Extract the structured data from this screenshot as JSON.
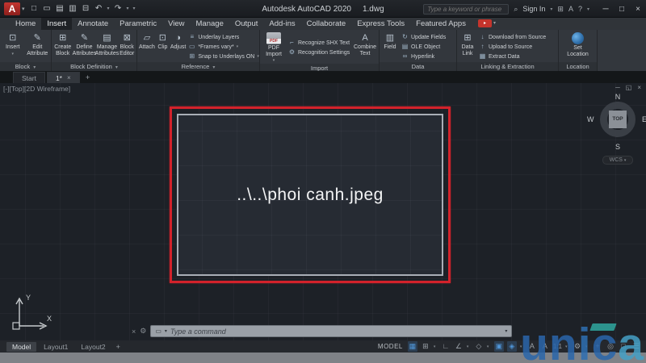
{
  "titlebar": {
    "app_title": "Autodesk AutoCAD 2020",
    "doc_title": "1.dwg",
    "search_placeholder": "Type a keyword or phrase",
    "sign_in": "Sign In"
  },
  "ribbon_tabs": [
    "Home",
    "Insert",
    "Annotate",
    "Parametric",
    "View",
    "Manage",
    "Output",
    "Add-ins",
    "Collaborate",
    "Express Tools",
    "Featured Apps"
  ],
  "panels": {
    "block": {
      "label": "Block",
      "insert": "Insert",
      "edit_attribute": "Edit Attribute"
    },
    "block_definition": {
      "label": "Block Definition",
      "create_block": "Create Block",
      "define_attributes": "Define Attributes",
      "manage_attributes": "Manage Attributes",
      "block_editor": "Block Editor"
    },
    "reference": {
      "label": "Reference",
      "attach": "Attach",
      "clip": "Clip",
      "adjust": "Adjust",
      "underlay_layers": "Underlay Layers",
      "frames_vary": "*Frames vary*",
      "snap_underlays": "Snap to Underlays ON"
    },
    "import_panel": {
      "label": "Import",
      "pdf_import": "PDF Import",
      "recognize_shx": "Recognize SHX Text",
      "recognition_settings": "Recognition Settings",
      "combine_text": "Combine Text"
    },
    "data": {
      "label": "Data",
      "field": "Field",
      "update_fields": "Update Fields",
      "ole_object": "OLE Object",
      "hyperlink": "Hyperlink"
    },
    "linking": {
      "label": "Linking & Extraction",
      "data_link": "Data Link",
      "download": "Download from Source",
      "upload": "Upload to Source",
      "extract": "Extract Data"
    },
    "location": {
      "label": "Location",
      "set_location": "Set Location"
    }
  },
  "file_tabs": {
    "start": "Start",
    "drawing": "1*",
    "new_tab": "+"
  },
  "viewport": {
    "label": "[-][Top][2D Wireframe]"
  },
  "viewcube": {
    "n": "N",
    "e": "E",
    "s": "S",
    "w": "W",
    "top": "TOP",
    "wcs": "WCS"
  },
  "canvas": {
    "image_label": "..\\..\\phoi canh.jpeg",
    "ucs_x": "X",
    "ucs_y": "Y"
  },
  "command": {
    "placeholder": "Type a command"
  },
  "statusbar": {
    "model": "Model",
    "layout1": "Layout1",
    "layout2": "Layout2",
    "new_layout": "+",
    "model_badge": "MODEL",
    "scale": "1:1"
  },
  "watermark": {
    "l1": "u",
    "l2": "n",
    "l3": "i",
    "l4": "c",
    "l5": "a"
  },
  "icons": {
    "logo": "A",
    "caret": "▾",
    "caret_right": "▸",
    "new_file": "□",
    "open": "▭",
    "save": "▤",
    "save_as": "▥",
    "plot": "⊟",
    "undo": "↶",
    "redo": "↷",
    "search": "⌕",
    "cart": "⊞",
    "store": "A",
    "help": "?",
    "minimize": "─",
    "maximize": "□",
    "close": "×",
    "restore": "◱",
    "insert_block": "⊡",
    "edit_attr": "✎",
    "create_block": "⊞",
    "define_attr": "✎",
    "manage_attr": "▤",
    "block_editor": "⊠",
    "attach": "▱",
    "clip": "⊡",
    "adjust": "◑",
    "layers": "≡",
    "frame": "▭",
    "snap_u": "⊞",
    "pdf": "PDF",
    "shx": "⌐",
    "settings": "⚙",
    "combine": "A",
    "field": "▥",
    "update": "↻",
    "ole": "▤",
    "hyperlink": "∞",
    "data_link": "⊞",
    "download": "↓",
    "upload": "↑",
    "extract": "▦",
    "grid": "▦",
    "snap": "⊞",
    "ortho": "∟",
    "polar": "∠",
    "isodraft": "◇",
    "osnap": "▣",
    "osnap3d": "◈",
    "annot": "A",
    "gear": "⚙",
    "plus": "+",
    "isolate": "◎",
    "clean": "□",
    "menu": "☰",
    "wrench": "⚙",
    "cmd_icon": "▭",
    "x": "×"
  }
}
